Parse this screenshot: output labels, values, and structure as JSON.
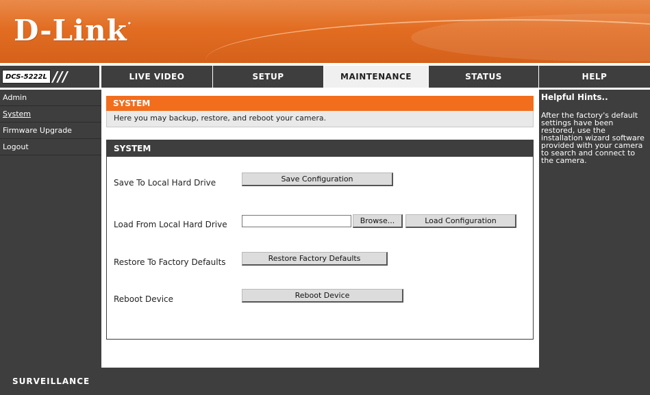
{
  "header": {
    "logo_text": "D-Link",
    "logo_mark": "·"
  },
  "nav": {
    "model": "DCS-5222L",
    "model_slashes": "///",
    "tabs": [
      {
        "label": "LIVE VIDEO"
      },
      {
        "label": "SETUP"
      },
      {
        "label": "MAINTENANCE",
        "active": true
      },
      {
        "label": "STATUS"
      },
      {
        "label": "HELP"
      }
    ]
  },
  "sidebar": {
    "items": [
      {
        "label": "Admin"
      },
      {
        "label": "System",
        "active": true
      },
      {
        "label": "Firmware Upgrade"
      },
      {
        "label": "Logout"
      }
    ]
  },
  "main": {
    "section_title": "SYSTEM",
    "description": "Here you may backup, restore, and reboot your camera.",
    "panel_title": "SYSTEM",
    "rows": [
      {
        "label": "Save To Local Hard Drive",
        "button": "Save Configuration"
      },
      {
        "label": "Load From Local Hard Drive",
        "browse": "Browse...",
        "file_value": "",
        "button": "Load Configuration"
      },
      {
        "label": "Restore To Factory Defaults",
        "button": "Restore Factory Defaults"
      },
      {
        "label": "Reboot Device",
        "button": "Reboot Device"
      }
    ]
  },
  "hints": {
    "title": "Helpful Hints..",
    "body": "After the factory's default settings have been restored, use the installation wizard software provided with your camera to search and connect to the camera."
  },
  "footer": {
    "label": "SURVEILLANCE"
  }
}
